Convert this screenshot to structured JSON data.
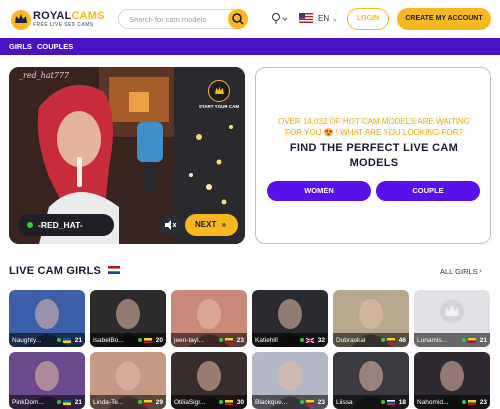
{
  "header": {
    "logo_royal": "ROYAL",
    "logo_cams": "CAMS",
    "logo_tagline": "FREE LIVE SEX CAMS",
    "search_placeholder": "Search for cam models",
    "language": "EN",
    "login_label": "LOGIN",
    "create_label": "CREATE MY ACCOUNT"
  },
  "nav": {
    "items": [
      {
        "label": "GIRLS"
      },
      {
        "label": "COUPLES"
      }
    ]
  },
  "featured": {
    "overlay_name": "_red_hat777",
    "start_cam_label": "START YOUR CAM",
    "model_name": "-RED_HAT-",
    "next_label": "NEXT"
  },
  "promo": {
    "subtitle_line1": "OVER 14,032 OF HOT CAM MODELS ARE WAITING",
    "subtitle_line2": "FOR YOU 😍 ! WHAT ARE YOU LOOKING FOR?",
    "title_line1": "FIND THE PERFECT LIVE CAM",
    "title_line2": "MODELS",
    "women_label": "WOMEN",
    "couple_label": "COUPLE"
  },
  "section": {
    "title": "LIVE CAM GIRLS",
    "all_link": "ALL GIRLS"
  },
  "models": [
    {
      "name": "Naughty...",
      "age": "21",
      "flag": "ukraine",
      "bg": "#3b5fa8"
    },
    {
      "name": "IsabelBo...",
      "age": "20",
      "flag": "colombia",
      "bg": "#2d2a2b"
    },
    {
      "name": "jeen-tayl...",
      "age": "23",
      "flag": "colombia",
      "bg": "#c98a7a"
    },
    {
      "name": "Katiehill",
      "age": "32",
      "flag": "uk",
      "bg": "#2a2a31"
    },
    {
      "name": "Dubraskal",
      "age": "46",
      "flag": "colombia",
      "bg": "#b8a88e"
    },
    {
      "name": "Lunamis...",
      "age": "21",
      "flag": "colombia",
      "bg": "#e2e2e6"
    },
    {
      "name": "PinkDom...",
      "age": "21",
      "flag": "ukraine",
      "bg": "#6a4a8c"
    },
    {
      "name": "Linda-Te...",
      "age": "29",
      "flag": "colombia",
      "bg": "#c49a86"
    },
    {
      "name": "OtiliaSigr...",
      "age": "30",
      "flag": "colombia",
      "bg": "#3a2d2e"
    },
    {
      "name": "Blackque...",
      "age": "23",
      "flag": "colombia",
      "bg": "#b4b7c6"
    },
    {
      "name": "Liissa",
      "age": "18",
      "flag": "russia",
      "bg": "#3b3a40"
    },
    {
      "name": "Nahomid...",
      "age": "23",
      "flag": "colombia",
      "bg": "#2f2a31"
    }
  ],
  "colors": {
    "brand": "#f7b820",
    "nav": "#4b12c4",
    "button": "#5a10e8"
  }
}
